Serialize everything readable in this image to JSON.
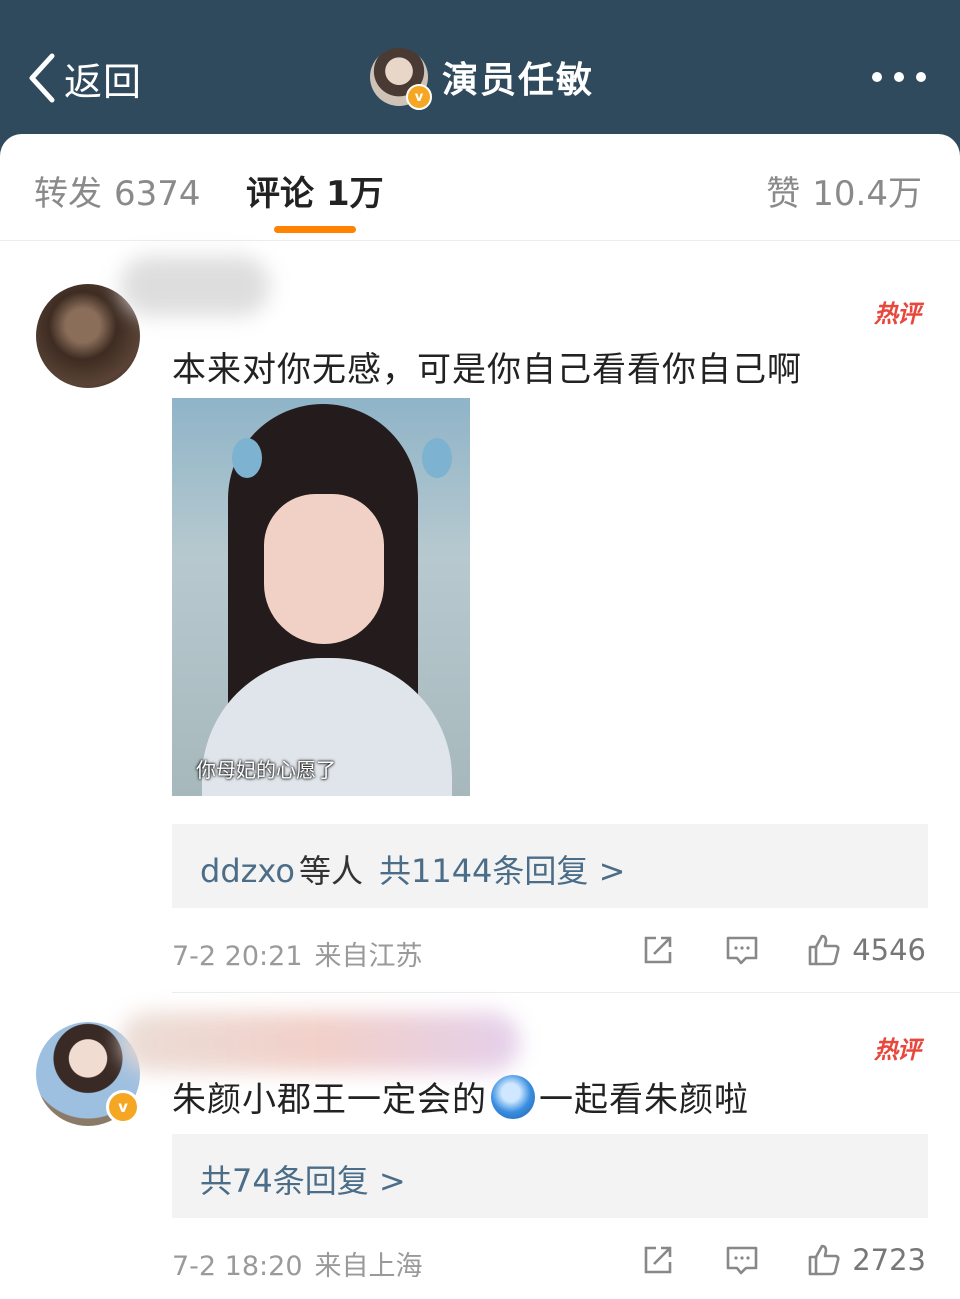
{
  "nav": {
    "back_label": "返回",
    "profile_name": "演员任敏",
    "verified_badge": "v"
  },
  "tabs": {
    "repost_label": "转发",
    "repost_count": "6374",
    "comment_label": "评论",
    "comment_count": "1万",
    "like_label": "赞",
    "like_count": "10.4万"
  },
  "comments": [
    {
      "hot_label": "热评",
      "text": "本来对你无感，可是你自己看看你自己啊",
      "media_caption": "你母妃的心愿了",
      "replies_user": "ddzxo",
      "replies_etc": "等人",
      "replies_total": "共1144条回复 >",
      "date": "7-2 20:21",
      "location": "来自江苏",
      "likes": "4546"
    },
    {
      "hot_label": "热评",
      "text_before_emoji": "朱颜小郡王一定会的",
      "text_after_emoji": "一起看朱颜啦",
      "verified_badge": "v",
      "replies_total": "共74条回复 >",
      "date": "7-2 18:20",
      "location": "来自上海",
      "likes": "2723"
    }
  ],
  "colors": {
    "header_bg": "#2f4a5c",
    "accent": "#ff8200",
    "hot": "#e8473c",
    "link": "#4b6d88",
    "verified": "#f5a623"
  }
}
